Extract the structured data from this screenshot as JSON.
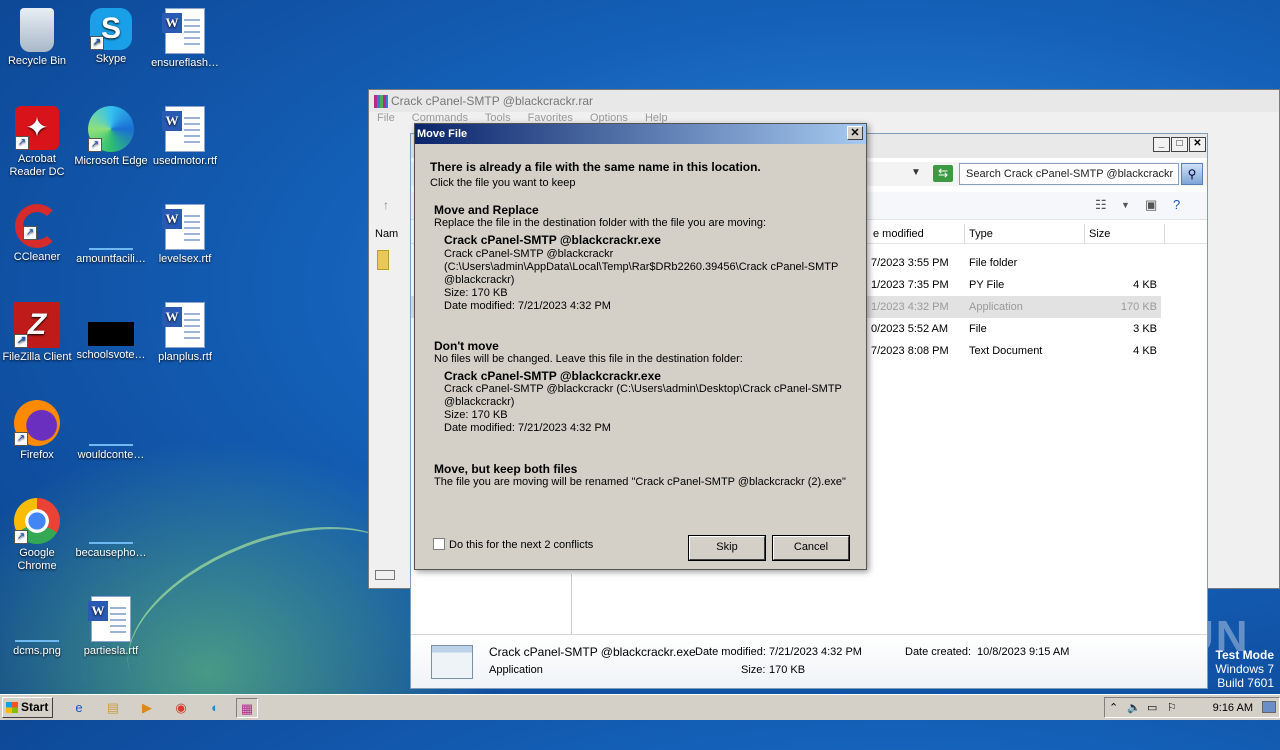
{
  "desktop": {
    "icons": [
      {
        "label": "Recycle Bin",
        "icon": "recycle-bin-icon"
      },
      {
        "label": "Skype",
        "icon": "skype-icon"
      },
      {
        "label": "ensureflash…",
        "icon": "word-document-icon"
      },
      {
        "label": "Acrobat Reader DC",
        "icon": "acrobat-icon"
      },
      {
        "label": "Microsoft Edge",
        "icon": "edge-icon"
      },
      {
        "label": "usedmotor.rtf",
        "icon": "word-document-icon"
      },
      {
        "label": "CCleaner",
        "icon": "ccleaner-icon"
      },
      {
        "label": "amountfacili…",
        "icon": "file-icon"
      },
      {
        "label": "levelsex.rtf",
        "icon": "word-document-icon"
      },
      {
        "label": "FileZilla Client",
        "icon": "filezilla-icon"
      },
      {
        "label": "schoolsvote…",
        "icon": "black-file-icon"
      },
      {
        "label": "planplus.rtf",
        "icon": "word-document-icon"
      },
      {
        "label": "Firefox",
        "icon": "firefox-icon"
      },
      {
        "label": "wouldconte…",
        "icon": "file-icon"
      },
      {
        "label": "Google Chrome",
        "icon": "chrome-icon"
      },
      {
        "label": "becausepho…",
        "icon": "file-icon"
      },
      {
        "label": "dcms.png",
        "icon": "file-icon"
      },
      {
        "label": "partiesla.rtf",
        "icon": "word-document-icon"
      }
    ]
  },
  "winrar": {
    "title": "Crack cPanel-SMTP @blackcrackr.rar",
    "menu": [
      "File",
      "Commands",
      "Tools",
      "Favorites",
      "Options",
      "Help"
    ],
    "name_col_partial": "Nam"
  },
  "explorer": {
    "search_placeholder": "Search Crack cPanel-SMTP @blackcrackr",
    "columns": {
      "modified": "e modified",
      "type": "Type",
      "size": "Size"
    },
    "rows": [
      {
        "modified": "7/2023 3:55 PM",
        "type": "File folder",
        "size": ""
      },
      {
        "modified": "1/2023 7:35 PM",
        "type": "PY File",
        "size": "4 KB"
      },
      {
        "modified": "1/2023 4:32 PM",
        "type": "Application",
        "size": "170 KB"
      },
      {
        "modified": "0/2023 5:52 AM",
        "type": "File",
        "size": "3 KB"
      },
      {
        "modified": "7/2023 8:08 PM",
        "type": "Text Document",
        "size": "4 KB"
      }
    ],
    "details": {
      "name": "Crack cPanel-SMTP @blackcrackr.exe",
      "kind": "Application",
      "modified_label": "Date modified:",
      "modified_value": "7/21/2023 4:32 PM",
      "size_label": "Size:",
      "size_value": "170 KB",
      "created_label": "Date created:",
      "created_value": "10/8/2023 9:15 AM"
    }
  },
  "dialog": {
    "title": "Move File",
    "heading": "There is already a file with the same name in this location.",
    "subheading": "Click the file you want to keep",
    "replace": {
      "title": "Move and Replace",
      "desc": "Replace the file in the destination folder with the file you are moving:",
      "file_name": "Crack cPanel-SMTP @blackcrackr.exe",
      "path1": "Crack cPanel-SMTP @blackcrackr",
      "path2": "(C:\\Users\\admin\\AppData\\Local\\Temp\\Rar$DRb2260.39456\\Crack cPanel-SMTP",
      "path3": "@blackcrackr)",
      "size": "Size: 170 KB",
      "modified": "Date modified: 7/21/2023 4:32 PM"
    },
    "dont_move": {
      "title": "Don't move",
      "desc": "No files will be changed. Leave this file in the destination folder:",
      "file_name": "Crack cPanel-SMTP @blackcrackr.exe",
      "path1": "Crack cPanel-SMTP @blackcrackr (C:\\Users\\admin\\Desktop\\Crack cPanel-SMTP",
      "path2": "@blackcrackr)",
      "size": "Size: 170 KB",
      "modified": "Date modified: 7/21/2023 4:32 PM"
    },
    "keep_both": {
      "title": "Move, but keep both files",
      "desc": "The file you are moving will be renamed \"Crack cPanel-SMTP @blackcrackr (2).exe\""
    },
    "checkbox_label": "Do this for the next 2 conflicts",
    "skip_label": "Skip",
    "cancel_label": "Cancel"
  },
  "taskbar": {
    "start_label": "Start",
    "clock": "9:16 AM",
    "apps": [
      "ie-icon",
      "explorer-icon",
      "media-player-icon",
      "chrome-icon",
      "edge-icon",
      "winrar-icon"
    ]
  },
  "watermark": "ANY.RUN",
  "test_mode": {
    "line1": "Test Mode",
    "line2": "Windows 7",
    "line3": "Build 7601"
  }
}
